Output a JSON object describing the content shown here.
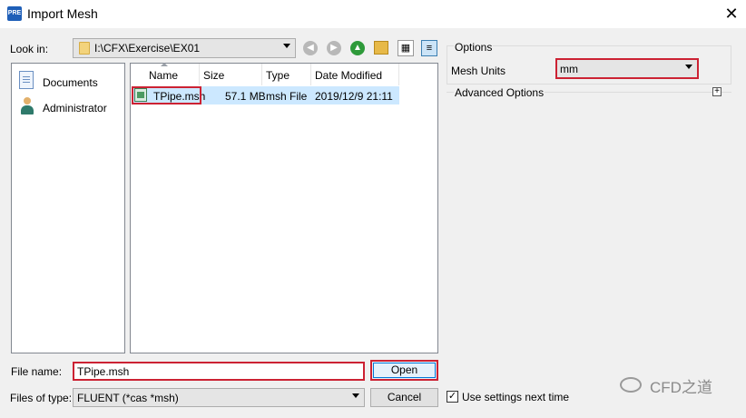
{
  "window": {
    "title": "Import Mesh",
    "app_badge": "PRE",
    "close_glyph": "✕"
  },
  "toolbar": {
    "look_in_label": "Look in:",
    "look_in_value": "I:\\CFX\\Exercise\\EX01",
    "icons": [
      "back-icon",
      "forward-icon",
      "up-folder-icon",
      "new-folder-icon",
      "list-view-icon",
      "detail-view-icon"
    ]
  },
  "sidebar": {
    "items": [
      {
        "label": "Documents",
        "icon": "documents-icon"
      },
      {
        "label": "Administrator",
        "icon": "user-icon"
      }
    ]
  },
  "file_list": {
    "columns": [
      "Name",
      "Size",
      "Type",
      "Date Modified"
    ],
    "rows": [
      {
        "name": "TPipe.msh",
        "size": "57.1 MB",
        "type": "msh File",
        "date_modified": "2019/12/9 21:11",
        "selected": true
      }
    ]
  },
  "form": {
    "file_name_label": "File name:",
    "file_name_value": "TPipe.msh",
    "files_of_type_label": "Files of type:",
    "files_of_type_value": "FLUENT (*cas *msh)",
    "open_label": "Open",
    "cancel_label": "Cancel"
  },
  "options": {
    "title": "Options",
    "mesh_units_label": "Mesh Units",
    "mesh_units_value": "mm",
    "advanced_label": "Advanced Options",
    "expand_glyph": "+"
  },
  "use_settings": {
    "label": "Use settings next time",
    "checked": true,
    "check_glyph": "✓"
  },
  "watermark": {
    "text": "CFD之道"
  },
  "colors": {
    "highlight": "#cc2233",
    "selection": "#cce8ff",
    "focus": "#0078d7"
  }
}
